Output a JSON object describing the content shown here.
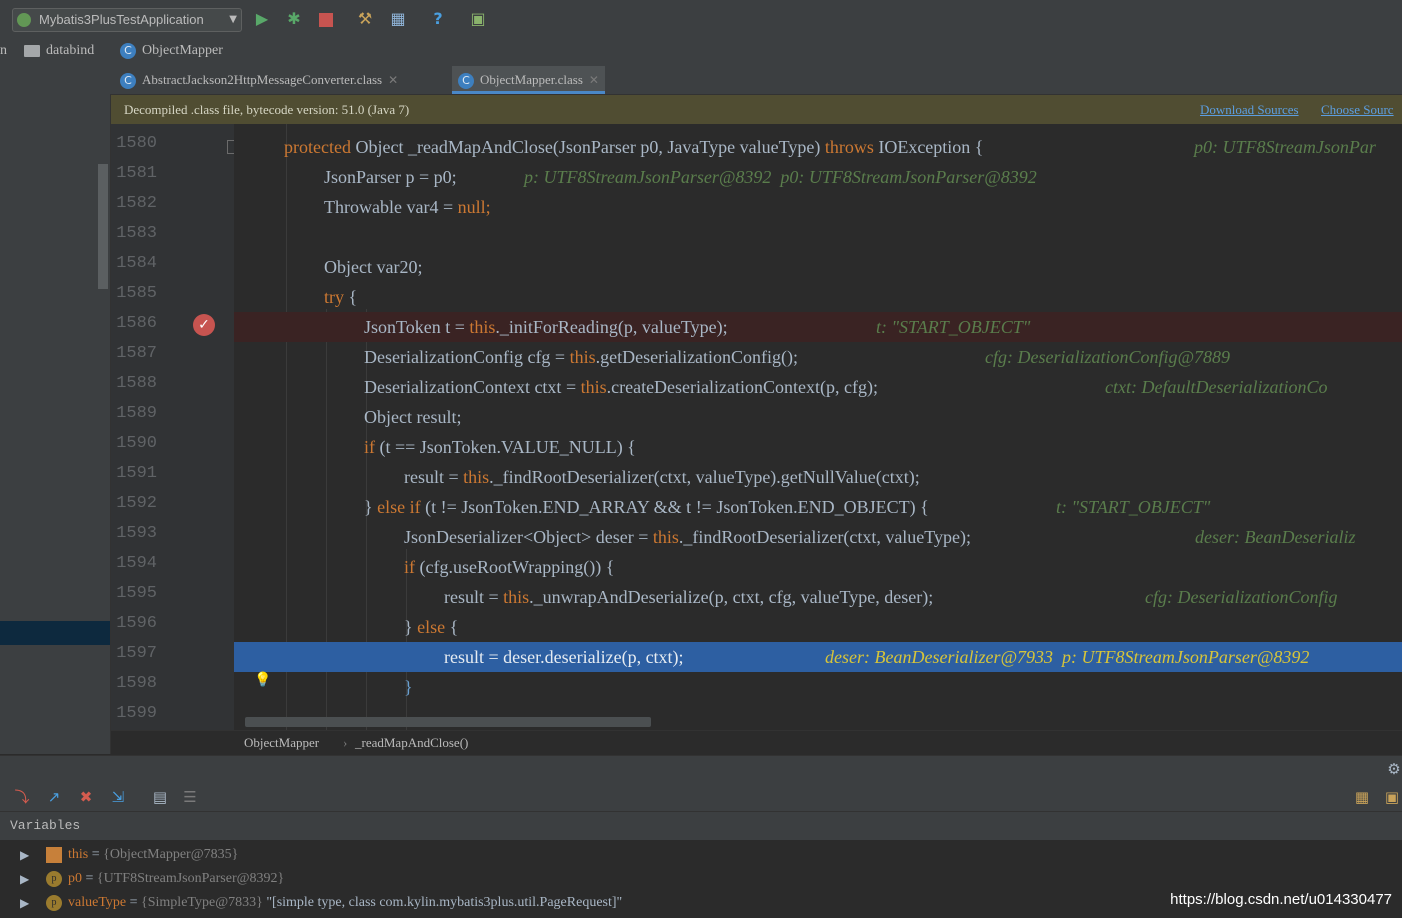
{
  "toolbar": {
    "run_config": "Mybatis3PlusTestApplication",
    "icons": [
      "run-icon",
      "debug-icon",
      "stop-icon",
      "build-icon",
      "structure-icon",
      "help-icon",
      "sdk-icon"
    ],
    "help_glyph": "?"
  },
  "navbar": {
    "left_cut": "n",
    "folder": "databind",
    "class": "ObjectMapper"
  },
  "tabs": [
    {
      "label": "AbstractJackson2HttpMessageConverter.class",
      "active": false
    },
    {
      "label": "ObjectMapper.class",
      "active": true
    }
  ],
  "banner": {
    "message": "Decompiled .class file, bytecode version: 51.0 (Java 7)",
    "download_sources": "Download Sources",
    "choose_sources": "Choose Sourc"
  },
  "editor": {
    "line_numbers": [
      "1580",
      "1581",
      "1582",
      "1583",
      "1584",
      "1585",
      "1586",
      "1587",
      "1588",
      "1589",
      "1590",
      "1591",
      "1592",
      "1593",
      "1594",
      "1595",
      "1596",
      "1597",
      "1598",
      "1599"
    ],
    "lines": [
      {
        "code_kw": "protected",
        "code": " Object _readMapAndClose(JsonParser p0, JavaType valueType) ",
        "code_kw2": "throws",
        "code2": " IOException {",
        "hint": "p0: UTF8StreamJsonPar"
      },
      {
        "code": "JsonParser p = p0;",
        "hint": "p: UTF8StreamJsonParser@8392  p0: UTF8StreamJsonParser@8392"
      },
      {
        "code": "Throwable var4 = ",
        "code_kw": "null;"
      },
      {
        "code": ""
      },
      {
        "code": "Object var20;"
      },
      {
        "code_kw": "try",
        "code": " {"
      },
      {
        "code": "JsonToken t = ",
        "code_kw": "this",
        "code2": "._initForReading(p, valueType);",
        "hint": "t: \"START_OBJECT\""
      },
      {
        "code": "DeserializationConfig cfg = ",
        "code_kw": "this",
        "code2": ".getDeserializationConfig();",
        "hint": "cfg: DeserializationConfig@7889"
      },
      {
        "code": "DeserializationContext ctxt = ",
        "code_kw": "this",
        "code2": ".createDeserializationContext(p, cfg);",
        "hint": "ctxt: DefaultDeserializationCo"
      },
      {
        "code": "Object result;"
      },
      {
        "code_kw": "if",
        "code": " (t == JsonToken.VALUE_NULL) {"
      },
      {
        "code": "result = ",
        "code_kw": "this",
        "code2": "._findRootDeserializer(ctxt, valueType).getNullValue(ctxt);"
      },
      {
        "code": "} ",
        "code_kw": "else if",
        "code2": " (t != JsonToken.END_ARRAY && t != JsonToken.END_OBJECT) {",
        "hint": "t: \"START_OBJECT\""
      },
      {
        "code": "JsonDeserializer<Object> deser = ",
        "code_kw": "this",
        "code2": "._findRootDeserializer(ctxt, valueType);",
        "hint": "deser: BeanDeserializ"
      },
      {
        "code_kw": "if",
        "code": " (cfg.useRootWrapping()) {"
      },
      {
        "code": "result = ",
        "code_kw": "this",
        "code2": "._unwrapAndDeserialize(p, ctxt, cfg, valueType, deser);",
        "hint": "cfg: DeserializationConfig"
      },
      {
        "code": "} ",
        "code_kw": "else",
        "code2": " {"
      },
      {
        "code": "result = deser.deserialize(p, ctxt);",
        "hint": "deser: BeanDeserializer@7933  p: UTF8StreamJsonParser@8392"
      },
      {
        "code": "}"
      },
      {
        "code": ""
      }
    ]
  },
  "bottom_breadcrumb": {
    "class": "ObjectMapper",
    "method": "_readMapAndClose()"
  },
  "debug": {
    "variables_label": "Variables",
    "vars": [
      {
        "name": "this",
        "value": "{ObjectMapper@7835}",
        "icon": "field-list-icon"
      },
      {
        "name": "p0",
        "value": "{UTF8StreamJsonParser@8392}",
        "icon": "parameter-icon",
        "icon_letter": "p"
      },
      {
        "name": "valueType",
        "value": "{SimpleType@7833}",
        "str": "\"[simple type, class com.kylin.mybatis3plus.util.PageRequest]\"",
        "icon": "parameter-icon",
        "icon_letter": "p"
      }
    ]
  },
  "watermark": "https://blog.csdn.net/u014330477"
}
